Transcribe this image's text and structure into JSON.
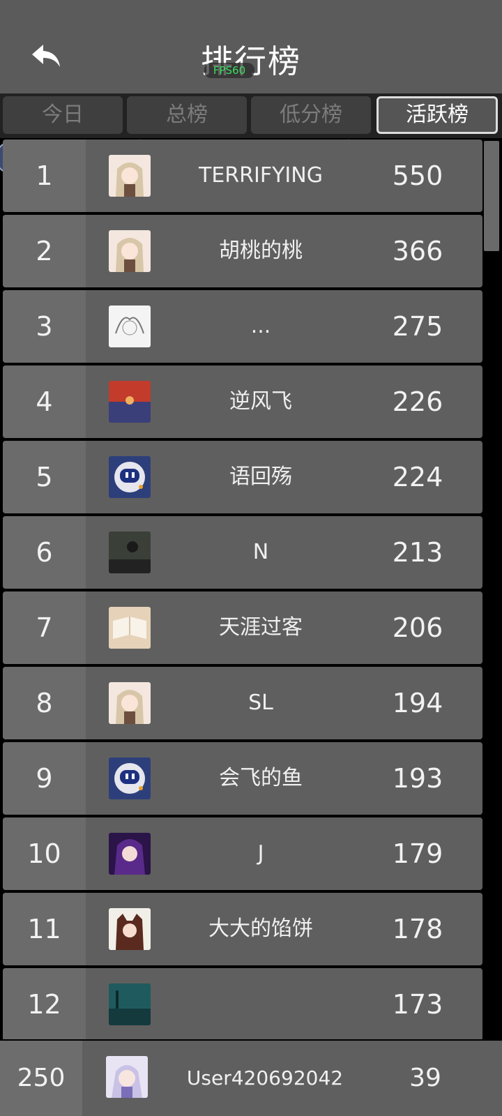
{
  "header": {
    "title": "排行榜",
    "fps": "FPS60",
    "back_icon": "back-arrow-icon"
  },
  "tabs": [
    {
      "label": "今日",
      "active": false
    },
    {
      "label": "总榜",
      "active": false
    },
    {
      "label": "低分榜",
      "active": false
    },
    {
      "label": "活跃榜",
      "active": true
    }
  ],
  "rows": [
    {
      "rank": "1",
      "name": "TERRIFYING",
      "score": "550",
      "avatar": "anime-girl-avatar"
    },
    {
      "rank": "2",
      "name": "胡桃的桃",
      "score": "366",
      "avatar": "anime-girl-avatar"
    },
    {
      "rank": "3",
      "name": "...",
      "score": "275",
      "avatar": "sketch-avatar"
    },
    {
      "rank": "4",
      "name": "逆风飞",
      "score": "226",
      "avatar": "sunset-avatar"
    },
    {
      "rank": "5",
      "name": "语回殇",
      "score": "224",
      "avatar": "robot-avatar"
    },
    {
      "rank": "6",
      "name": "N",
      "score": "213",
      "avatar": "photo-avatar"
    },
    {
      "rank": "7",
      "name": "天涯过客",
      "score": "206",
      "avatar": "book-avatar"
    },
    {
      "rank": "8",
      "name": "SL",
      "score": "194",
      "avatar": "anime-girl-avatar"
    },
    {
      "rank": "9",
      "name": "会飞的鱼",
      "score": "193",
      "avatar": "robot-avatar"
    },
    {
      "rank": "10",
      "name": "J",
      "score": "179",
      "avatar": "anime-dark-avatar"
    },
    {
      "rank": "11",
      "name": "大大的馅饼",
      "score": "178",
      "avatar": "anime-fox-avatar"
    },
    {
      "rank": "12",
      "name": "",
      "score": "173",
      "avatar": "scenery-avatar"
    }
  ],
  "footer": {
    "rank": "250",
    "name": "User420692042",
    "score": "39",
    "avatar": "anime-silver-avatar"
  }
}
